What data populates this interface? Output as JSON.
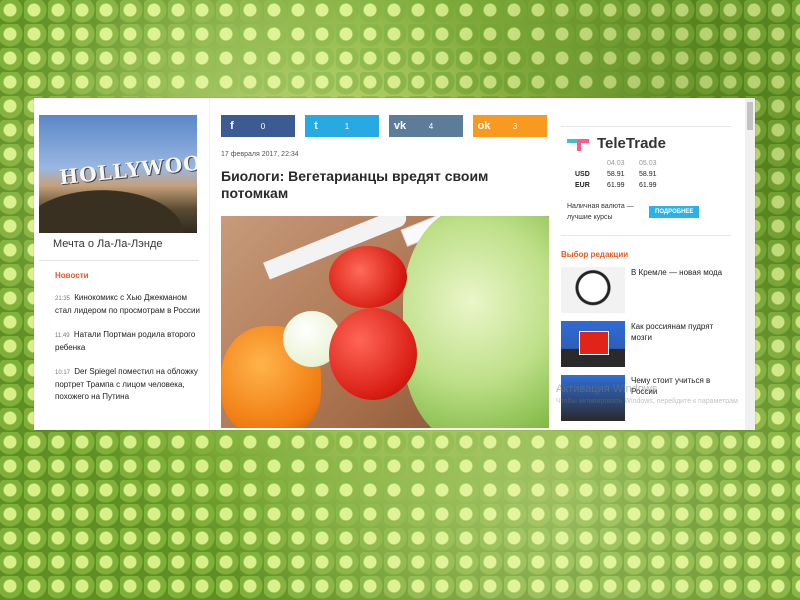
{
  "left": {
    "hero_text": "HOLLYWOOD",
    "hero_caption": "Мечта о Ла-Ла-Лэнде",
    "section_title": "Новости",
    "news": [
      {
        "time": "21:35",
        "text": "Кинокомикс с Хью Джекманом стал лидером по просмотрам в России"
      },
      {
        "time": "11:49",
        "text": "Натали Портман родила второго ребенка"
      },
      {
        "time": "10:17",
        "text": "Der Spiegel поместил на обложку портрет Трампа с лицом человека, похожего на Путина"
      }
    ]
  },
  "shares": [
    {
      "network": "facebook",
      "icon": "f",
      "count": "0",
      "color": "#3b5b92"
    },
    {
      "network": "twitter",
      "icon": "t",
      "count": "1",
      "color": "#27a9e1"
    },
    {
      "network": "vk",
      "icon": "vk",
      "count": "4",
      "color": "#5c7c9a"
    },
    {
      "network": "odnoklassniki",
      "icon": "ok",
      "count": "3",
      "color": "#f79a1f"
    }
  ],
  "article": {
    "date": "17 февраля 2017, 22:34",
    "headline": "Биологи: Вегетарианцы вредят своим потомкам"
  },
  "sidebar": {
    "brand": "TeleTrade",
    "rates": {
      "dates": [
        "04.03",
        "05.03"
      ],
      "rows": [
        {
          "currency": "USD",
          "v1": "58.91",
          "v2": "58.91"
        },
        {
          "currency": "EUR",
          "v1": "61.99",
          "v2": "61.99"
        }
      ]
    },
    "cash_text": "Наличная валюта — лучшие курсы",
    "more_button": "ПОДРОБНЕЕ",
    "editor_title": "Выбор редакции",
    "editor_items": [
      {
        "title": "В Кремле — новая мода",
        "thumb_text": ""
      },
      {
        "title": "Как россиянам пудрят мозги",
        "thumb_text": "ВСЕ У НАС ХОРОШО!"
      },
      {
        "title": "Чему стоит учиться в России",
        "thumb_text": ""
      }
    ]
  },
  "watermark": {
    "line1": "Активация Windows",
    "line2": "Чтобы активировать Windows, перейдите к параметрам"
  }
}
